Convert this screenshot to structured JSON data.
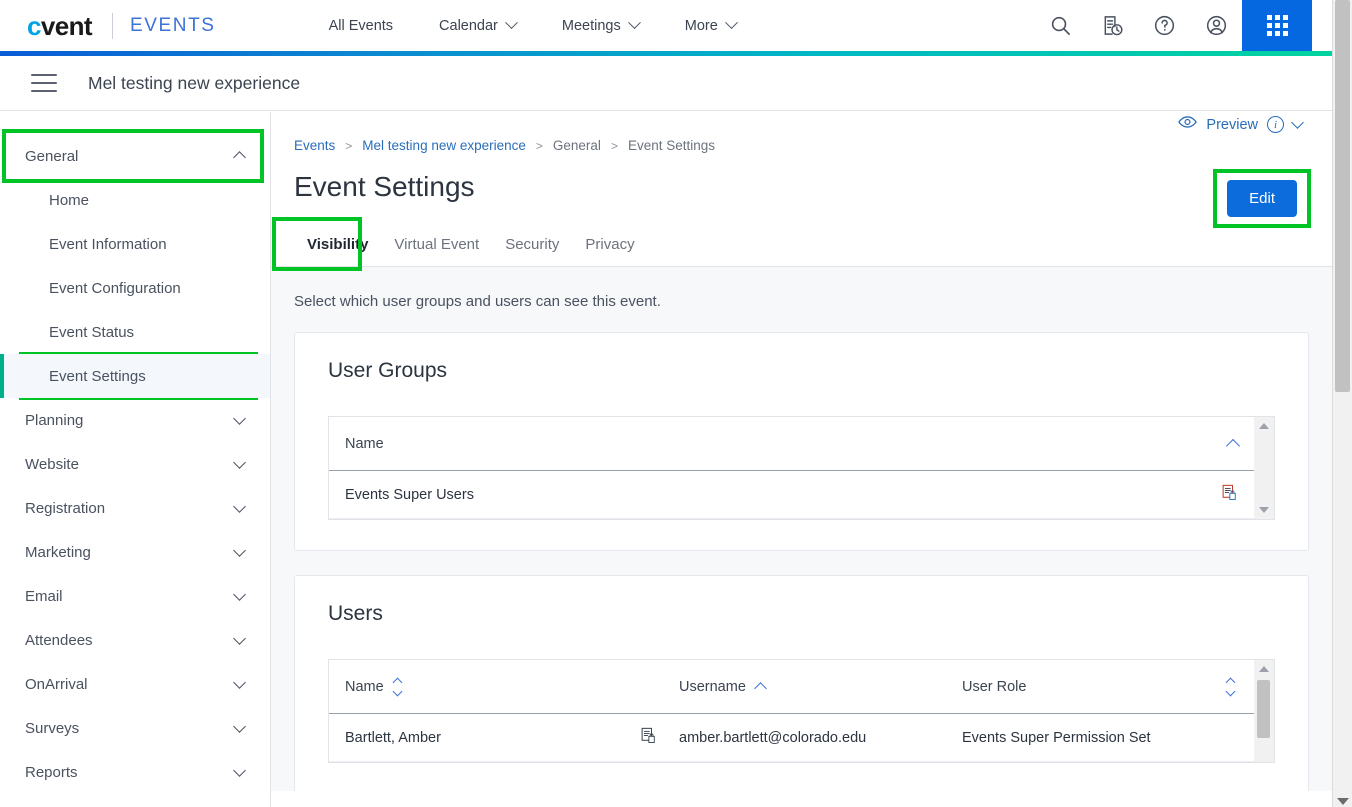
{
  "brand": {
    "logo": "cvent",
    "product": "EVENTS"
  },
  "topnav": [
    {
      "label": "All Events",
      "has_caret": false
    },
    {
      "label": "Calendar",
      "has_caret": true
    },
    {
      "label": "Meetings",
      "has_caret": true
    },
    {
      "label": "More",
      "has_caret": true
    }
  ],
  "topicons": [
    {
      "name": "search-icon"
    },
    {
      "name": "document-clock-icon"
    },
    {
      "name": "help-icon"
    },
    {
      "name": "account-icon"
    },
    {
      "name": "app-grid-icon"
    }
  ],
  "subheader": {
    "menu_icon": "hamburger-icon",
    "event_title": "Mel testing new experience"
  },
  "sidebar": {
    "groups": [
      {
        "label": "General",
        "expanded": true,
        "caret": "chevron-up-icon",
        "highlighted": true,
        "children": [
          {
            "label": "Home",
            "active": false
          },
          {
            "label": "Event Information",
            "active": false
          },
          {
            "label": "Event Configuration",
            "active": false
          },
          {
            "label": "Event Status",
            "active": false
          },
          {
            "label": "Event Settings",
            "active": true,
            "highlighted": true
          }
        ]
      },
      {
        "label": "Planning",
        "expanded": false,
        "caret": "chevron-down-icon",
        "children": []
      },
      {
        "label": "Website",
        "expanded": false,
        "caret": "chevron-down-icon",
        "children": []
      },
      {
        "label": "Registration",
        "expanded": false,
        "caret": "chevron-down-icon",
        "children": []
      },
      {
        "label": "Marketing",
        "expanded": false,
        "caret": "chevron-down-icon",
        "children": []
      },
      {
        "label": "Email",
        "expanded": false,
        "caret": "chevron-down-icon",
        "children": []
      },
      {
        "label": "Attendees",
        "expanded": false,
        "caret": "chevron-down-icon",
        "children": []
      },
      {
        "label": "OnArrival",
        "expanded": false,
        "caret": "chevron-down-icon",
        "children": []
      },
      {
        "label": "Surveys",
        "expanded": false,
        "caret": "chevron-down-icon",
        "children": []
      },
      {
        "label": "Reports",
        "expanded": false,
        "caret": "chevron-down-icon",
        "children": []
      }
    ]
  },
  "breadcrumb": [
    {
      "label": "Events",
      "link": true
    },
    {
      "label": "Mel testing new experience",
      "link": true
    },
    {
      "label": "General",
      "link": false
    },
    {
      "label": "Event Settings",
      "link": false
    }
  ],
  "page": {
    "title": "Event Settings",
    "preview_label": "Preview",
    "edit_label": "Edit",
    "lead_text": "Select which user groups and users can see this event."
  },
  "tabs": [
    {
      "label": "Visibility",
      "active": true,
      "highlighted": true
    },
    {
      "label": "Virtual Event",
      "active": false
    },
    {
      "label": "Security",
      "active": false
    },
    {
      "label": "Privacy",
      "active": false
    }
  ],
  "user_groups": {
    "title": "User Groups",
    "columns": [
      {
        "label": "Name",
        "sort": "none"
      }
    ],
    "rows": [
      {
        "name": "Events Super Users",
        "icon": "document-lock-icon"
      }
    ]
  },
  "users": {
    "title": "Users",
    "columns": [
      {
        "label": "Name",
        "sort": "both"
      },
      {
        "label": "Username",
        "sort": "asc"
      },
      {
        "label": "User Role",
        "sort": "both"
      }
    ],
    "rows": [
      {
        "name": "Bartlett, Amber",
        "icon": "document-lock-icon",
        "username": "amber.bartlett@colorado.edu",
        "role": "Events Super Permission Set"
      }
    ]
  },
  "colors": {
    "accent_blue": "#0668e1",
    "brand_cyan": "#00a4e4",
    "highlight_green": "#00c425",
    "active_teal": "#00b088",
    "link_blue": "#2a6ebb"
  }
}
